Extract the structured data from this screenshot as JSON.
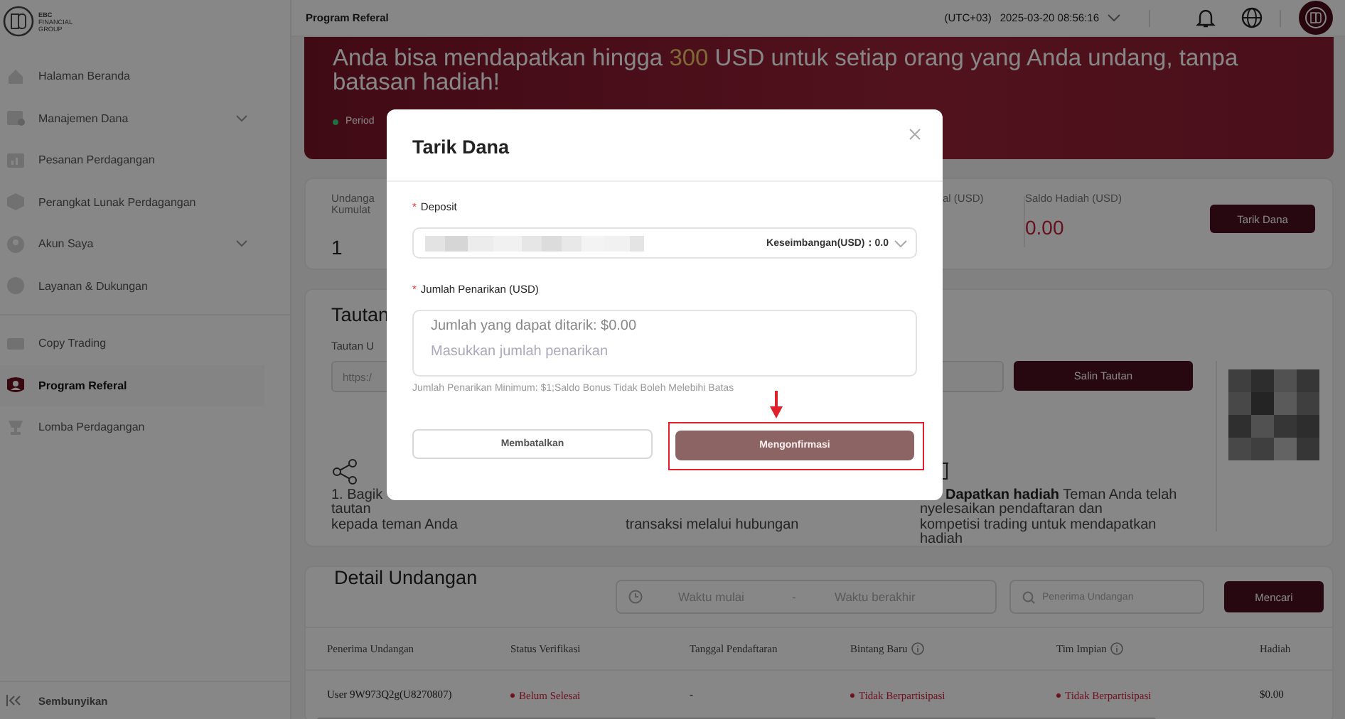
{
  "sidebar": {
    "logo": {
      "lines": [
        "EBC",
        "FINANCIAL",
        "GROUP"
      ]
    },
    "groups": [
      [
        {
          "label": "Halaman Beranda",
          "expandable": false,
          "selected": false
        },
        {
          "label": "Manajemen Dana",
          "expandable": true,
          "selected": false
        },
        {
          "label": "Pesanan Perdagangan",
          "expandable": false,
          "selected": false
        },
        {
          "label": "Perangkat Lunak Perdagangan",
          "expandable": false,
          "selected": false
        },
        {
          "label": "Akun Saya",
          "expandable": true,
          "selected": false
        },
        {
          "label": "Layanan & Dukungan",
          "expandable": false,
          "selected": false
        }
      ],
      [
        {
          "label": "Copy Trading",
          "expandable": false,
          "selected": false
        },
        {
          "label": "Program Referal",
          "expandable": false,
          "selected": true
        },
        {
          "label": "Lomba Perdagangan",
          "expandable": false,
          "selected": false
        }
      ]
    ],
    "collapse_label": "Sembunyikan"
  },
  "header": {
    "page_title": "Program Referal",
    "timezone": "(UTC+03)",
    "datetime": "2025-03-20 08:56:16"
  },
  "banner": {
    "headline": {
      "before": "Anda bisa mendapatkan hingga ",
      "highlight": "300",
      "after": " USD untuk setiap orang yang Anda undang, tanpa batasan hadiah!"
    },
    "period": "Period"
  },
  "stats": {
    "items": [
      {
        "kind": "count",
        "label": "Undanga\nKumulat",
        "value": "1"
      },
      {
        "kind": "plain",
        "label": "al (USD)"
      },
      {
        "kind": "reward",
        "label": "Saldo Hadiah (USD)",
        "value": "0.00"
      }
    ],
    "button": "Tarik Dana"
  },
  "link_card": {
    "title": "Tautan",
    "field_label": "Tautan U",
    "link_value": "https:/",
    "copy_button": "Salin Tautan",
    "steps": [
      {
        "text": "1. Bagik\ntautan\nkepada teman Anda"
      },
      {
        "text": "transaksi melalui hubungan"
      },
      {
        "text": "**Dapatkan hadiah**   Teman Anda telah\nnyelesaikan pendaftaran dan\nkompetisi trading untuk mendapatkan\nhadiah"
      }
    ]
  },
  "detail": {
    "title": "Detail Undangan",
    "start_placeholder": "Waktu mulai",
    "range_separator": "-",
    "end_placeholder": "Waktu berakhir",
    "search_placeholder": "Penerima Undangan",
    "search_button": "Mencari",
    "table": {
      "columns": [
        {
          "label": "Penerima Undangan",
          "info": false
        },
        {
          "label": "Status Verifikasi",
          "info": false
        },
        {
          "label": "Tanggal Pendaftaran",
          "info": false
        },
        {
          "label": "Bintang Baru",
          "info": true
        },
        {
          "label": "Tim Impian",
          "info": true
        },
        {
          "label": "Hadiah",
          "info": false
        }
      ],
      "rows": [
        [
          {
            "kind": "text",
            "text": "User 9W973Q2g(U8270807)"
          },
          {
            "kind": "status",
            "text": "Belum Selesai"
          },
          {
            "kind": "text",
            "text": "-"
          },
          {
            "kind": "status",
            "text": "Tidak Berpartisipasi"
          },
          {
            "kind": "status",
            "text": "Tidak Berpartisipasi"
          },
          {
            "kind": "text",
            "text": "$0.00"
          }
        ]
      ]
    }
  },
  "modal": {
    "title": "Tarik Dana",
    "fields": [
      {
        "mark": "*",
        "label": "Deposit"
      },
      {
        "mark": "*",
        "label": "Jumlah Penarikan (USD)"
      }
    ],
    "balance": "Keseimbangan(USD)：0.0",
    "available": "Jumlah yang dapat ditarik: $0.00",
    "amount_placeholder": "Masukkan jumlah penarikan",
    "hint": "Jumlah Penarikan Minimum: $1;Saldo Bonus Tidak Boleh Melebihi Batas",
    "cancel": "Membatalkan",
    "confirm": {
      "label": "Mengonfirmasi",
      "disabled": true
    }
  }
}
